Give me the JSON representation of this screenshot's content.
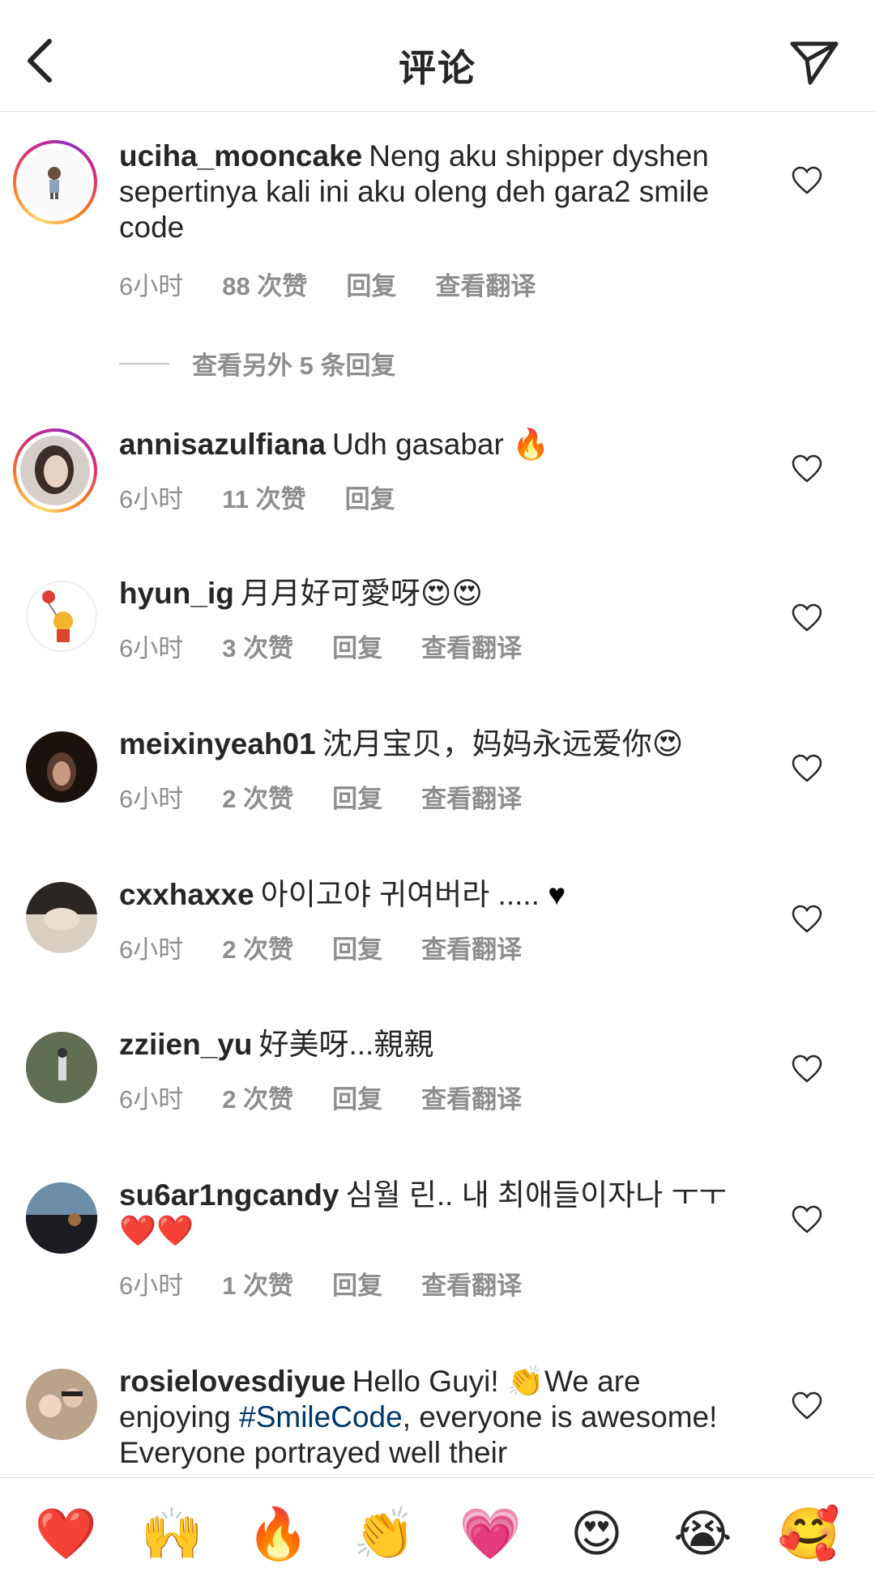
{
  "header": {
    "title": "评论"
  },
  "comments": [
    {
      "username": "uciha_mooncake",
      "text": "Neng aku shipper dyshen sepertinya kali ini aku oleng deh gara2 smile code",
      "time": "6小时",
      "likes": "88 次赞",
      "reply": "回复",
      "translate": "查看翻译",
      "view_replies": "查看另外 5 条回复"
    },
    {
      "username": "annisazulfiana",
      "text": "Udh gasabar",
      "emoji": "🔥",
      "time": "6小时",
      "likes": "11 次赞",
      "reply": "回复"
    },
    {
      "username": "hyun_ig",
      "text": "月月好可愛呀",
      "emoji": "😍😍",
      "time": "6小时",
      "likes": "3 次赞",
      "reply": "回复",
      "translate": "查看翻译"
    },
    {
      "username": "meixinyeah01",
      "text": "沈月宝贝，妈妈永远爱你",
      "emoji": "😍",
      "time": "6小时",
      "likes": "2 次赞",
      "reply": "回复",
      "translate": "查看翻译"
    },
    {
      "username": "cxxhaxxe",
      "text": "아이고야 귀여버라 .....",
      "emoji": "♥",
      "time": "6小时",
      "likes": "2 次赞",
      "reply": "回复",
      "translate": "查看翻译"
    },
    {
      "username": "zziien_yu",
      "text": "好美呀...親親",
      "time": "6小时",
      "likes": "2 次赞",
      "reply": "回复",
      "translate": "查看翻译"
    },
    {
      "username": "su6ar1ngcandy",
      "text": "심월 린.. 내 최애들이자나 ㅜㅜ",
      "emoji": "❤️❤️",
      "time": "6小时",
      "likes": "1 次赞",
      "reply": "回复",
      "translate": "查看翻译"
    },
    {
      "username": "rosielovesdiyue",
      "text_part1": "Hello Guyi!",
      "emoji": "👏",
      "text_part2": "We are enjoying",
      "hashtag": "#SmileCode",
      "text_part3": ", everyone is awesome! Everyone portrayed well their"
    }
  ],
  "emoji_bar": [
    "❤️",
    "🙌",
    "🔥",
    "👏",
    "💗",
    "😍",
    "😭",
    "🥰"
  ],
  "colors": {
    "meta": "#8e8e8e",
    "hashtag": "#00376b",
    "text": "#262626",
    "divider": "#dbdbdb"
  }
}
